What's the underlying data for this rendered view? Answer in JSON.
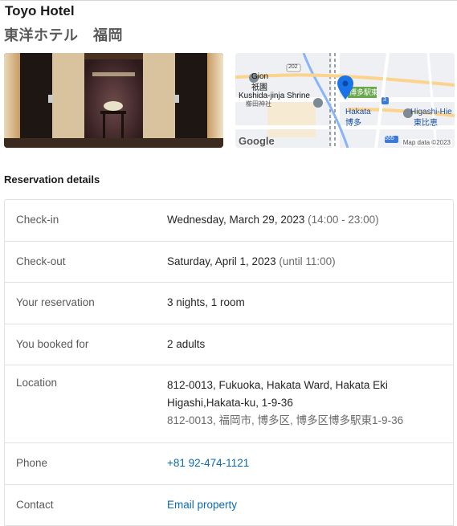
{
  "hotel": {
    "name": "Toyo Hotel",
    "name_jp": "東洋ホテル　福岡"
  },
  "map": {
    "labels": {
      "gion_en": "Gion",
      "gion_jp": "祇園",
      "kushida_en": "Kushida-jinja Shrine",
      "kushida_jp": "櫛田神社",
      "hakata_en": "Hakata",
      "hakata_jp": "博多",
      "hakata_eki": "博多駅東",
      "higashi_en": "Higashi-Hie",
      "higashi_jp": "東比恵",
      "route_202": "202",
      "route_555": "555",
      "route_3": "3"
    },
    "google_logo": "Google",
    "credit": "Map data ©2023"
  },
  "section_title": "Reservation details",
  "details": {
    "checkin": {
      "label": "Check-in",
      "date": "Wednesday, March 29, 2023",
      "time": "(14:00 - 23:00)"
    },
    "checkout": {
      "label": "Check-out",
      "date": "Saturday, April 1, 2023",
      "time": "(until 11:00)"
    },
    "reservation": {
      "label": "Your reservation",
      "value": "3 nights, 1 room"
    },
    "booked_for": {
      "label": "You booked for",
      "value": "2 adults"
    },
    "location": {
      "label": "Location",
      "line1": "812-0013, Fukuoka, Hakata Ward, Hakata Eki",
      "line2": "Higashi,Hakata-ku, 1-9-36",
      "line3": "812-0013, 福岡市, 博多区, 博多区博多駅東1-9-36"
    },
    "phone": {
      "label": "Phone",
      "value": "+81 92-474-1121"
    },
    "contact": {
      "label": "Contact",
      "value": "Email property"
    }
  },
  "colors": {
    "link": "#0a6ab5",
    "pin": "#1a73e8"
  }
}
